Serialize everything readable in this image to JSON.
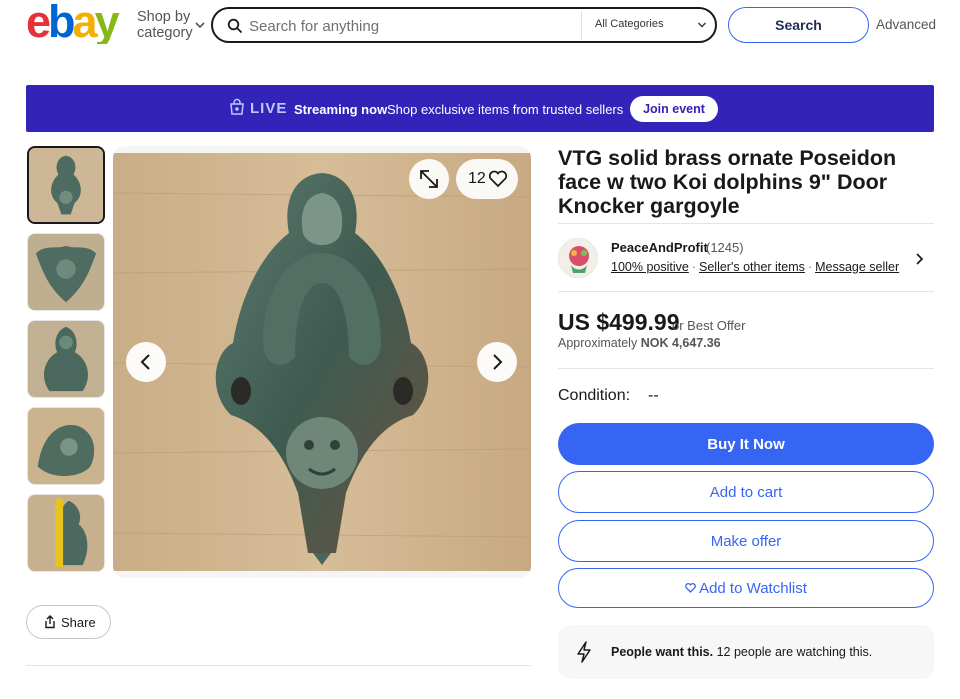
{
  "header": {
    "logo_text": "ebay",
    "shop_by_line1": "Shop by",
    "shop_by_line2": "category",
    "search_placeholder": "Search for anything",
    "category": "All Categories",
    "search_button": "Search",
    "advanced_link": "Advanced"
  },
  "banner": {
    "live_label": "LIVE",
    "streaming_now": "Streaming now",
    "description": "Shop exclusive items from trusted sellers",
    "join_button": "Join event",
    "background": "#3323b8"
  },
  "gallery": {
    "thumbnail_count": 5,
    "selected_index": 0,
    "image_count_label": "12",
    "share_label": "Share"
  },
  "listing": {
    "title": "VTG solid brass ornate Poseidon face w two Koi dolphins 9\" Door Knocker gargoyle",
    "seller": {
      "name": "PeaceAndProfit",
      "feedback_count": "(1245)",
      "positive": "100% positive",
      "other_items": "Seller's other items",
      "message": "Message seller"
    },
    "price": "US $499.99",
    "best_offer": "or Best Offer",
    "approx_label": "Approximately",
    "approx_value": "NOK 4,647.36",
    "condition_label": "Condition:",
    "condition_value": "--",
    "buy_now": "Buy It Now",
    "add_to_cart": "Add to cart",
    "make_offer": "Make offer",
    "add_to_watchlist": "Add to Watchlist",
    "watch_bold": "People want this.",
    "watch_text": "12 people are watching this."
  },
  "colors": {
    "accent": "#3665f3",
    "text": "#191919",
    "ebay_red": "#e53238",
    "ebay_blue": "#0064d2",
    "ebay_yellow": "#f5af02",
    "ebay_green": "#86b817"
  },
  "icons": [
    "search-icon",
    "chevron-down-icon",
    "live-bag-icon",
    "expand-icon",
    "heart-icon",
    "chevron-left-icon",
    "chevron-right-icon",
    "share-icon",
    "lightning-icon"
  ]
}
